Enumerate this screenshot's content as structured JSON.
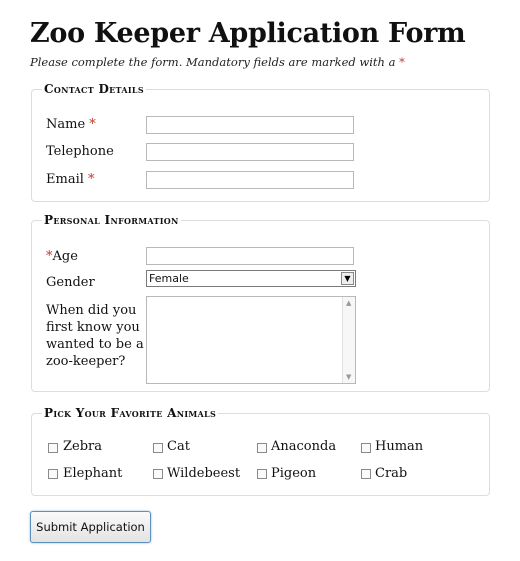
{
  "form": {
    "title": "Zoo Keeper Application Form",
    "subtitle": "Please complete the form. Mandatory fields are marked with a",
    "required_marker": "*"
  },
  "contact": {
    "legend": "Contact Details",
    "name_label": "Name",
    "telephone_label": "Telephone",
    "email_label": "Email",
    "name_value": "",
    "telephone_value": "",
    "email_value": ""
  },
  "personal": {
    "legend": "Personal Information",
    "age_label": "Age",
    "age_value": "",
    "gender_label": "Gender",
    "gender_selected": "Female",
    "question_lines": [
      "When did you",
      "first know you",
      "wanted to be a",
      "zoo-keeper?"
    ],
    "question_value": ""
  },
  "animals": {
    "legend": "Pick Your Favorite Animals",
    "items": [
      "Zebra",
      "Cat",
      "Anaconda",
      "Human",
      "Elephant",
      "Wildebeest",
      "Pigeon",
      "Crab"
    ]
  },
  "submit_label": "Submit Application",
  "colors": {
    "required": "#c0392b",
    "button_border": "#5e8fbd"
  },
  "icons": {
    "select_arrow": "chevron-down-icon",
    "scroll_up": "arrow-up-icon",
    "scroll_down": "arrow-down-icon"
  }
}
